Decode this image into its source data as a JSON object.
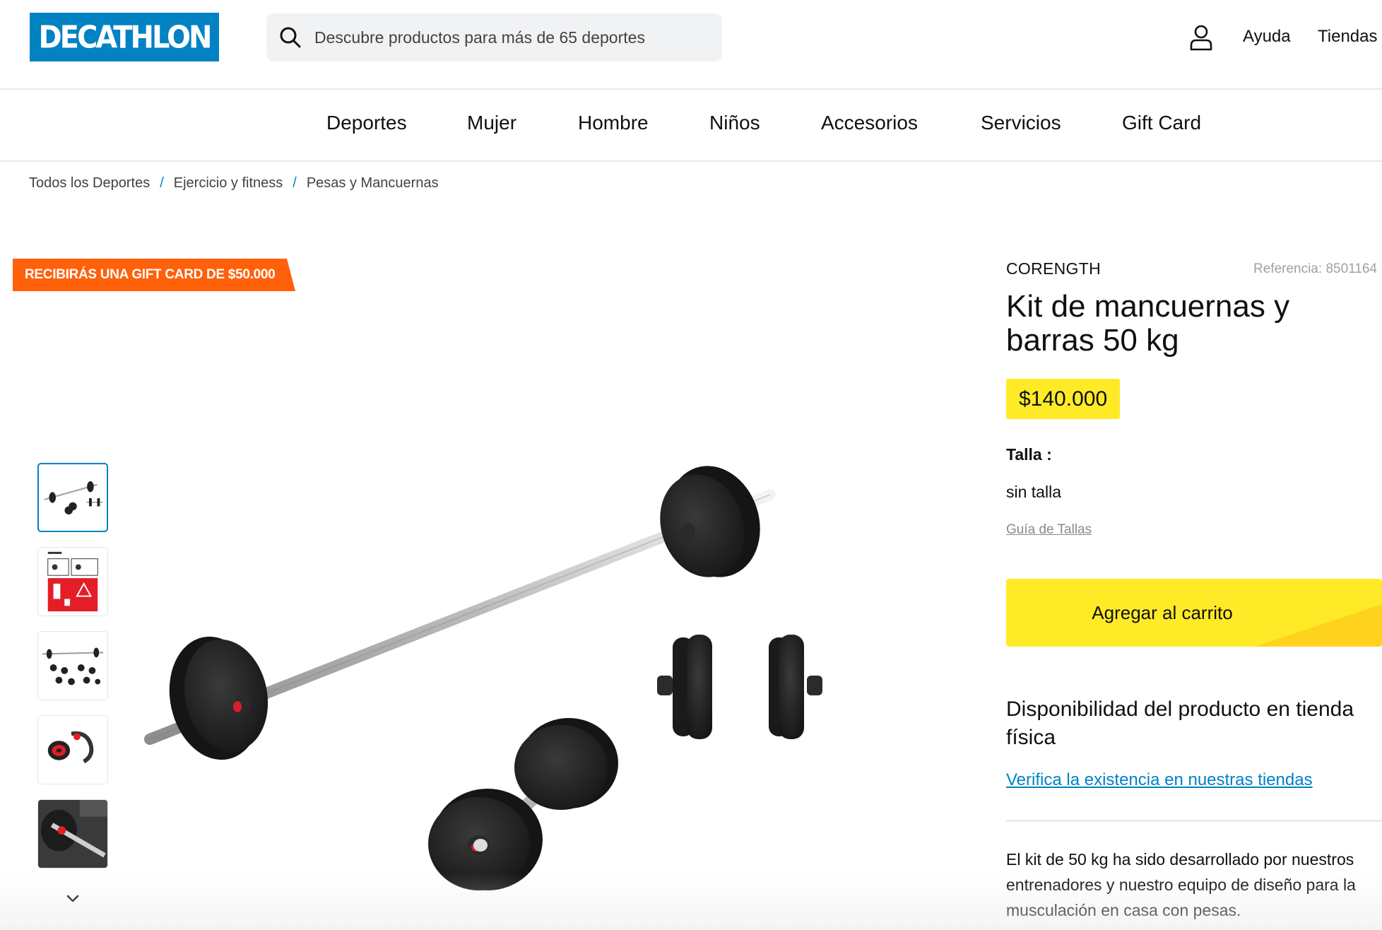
{
  "header": {
    "logo_text": "DECATHLON",
    "search_placeholder": "Descubre productos para más de 65 deportes",
    "links": [
      "Ayuda",
      "Tiendas"
    ]
  },
  "nav": {
    "items": [
      "Deportes",
      "Mujer",
      "Hombre",
      "Niños",
      "Accesorios",
      "Servicios",
      "Gift Card"
    ]
  },
  "breadcrumb": {
    "items": [
      "Todos los Deportes",
      "Ejercicio y fitness",
      "Pesas y Mancuernas"
    ],
    "separator": "/"
  },
  "promo": {
    "text": "RECIBIRÁS UNA GIFT CARD DE $50.000"
  },
  "gallery": {
    "thumbnail_count": 5,
    "selected_index": 0
  },
  "product": {
    "brand": "CORENGTH",
    "reference": "Referencia: 8501164",
    "title": "Kit de mancuernas y barras 50 kg",
    "price": "$140.000",
    "size_label": "Talla :",
    "size_value": "sin talla",
    "size_guide": "Guía de Tallas",
    "add_to_cart": "Agregar al carrito",
    "availability_title": "Disponibilidad del producto en tienda física",
    "availability_link": "Verifica la existencia en nuestras tiendas",
    "description": "El kit de 50 kg ha sido desarrollado por nuestros entrenadores y nuestro equipo de diseño para la musculación en casa con pesas."
  },
  "colors": {
    "brand_blue": "#0082c3",
    "promo_orange": "#ff600a",
    "price_yellow": "#ffea28"
  }
}
